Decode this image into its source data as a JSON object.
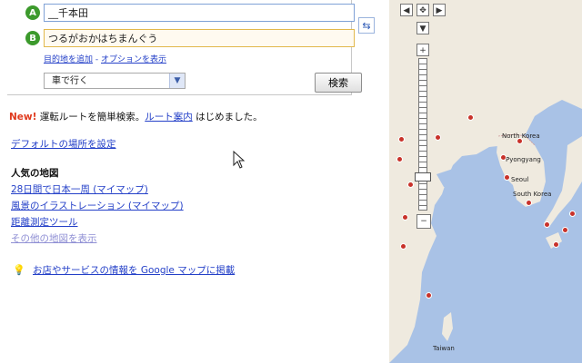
{
  "route": {
    "start_marker": "A",
    "end_marker": "B",
    "start_value": "__千本田",
    "end_value": "つるがおかはちまんぐう",
    "swap_label": "⇆",
    "dest_link_1": "目的地を追加",
    "dest_sep": " - ",
    "dest_link_2": "オプションを表示",
    "mode_value": "車で行く",
    "search_label": "検索"
  },
  "announcement": {
    "new_label": "New!",
    "text_before": " 運転ルートを簡単検索。",
    "link_text": "ルート案内",
    "text_after": " はじめました。"
  },
  "default_location_link": "デフォルトの場所を設定",
  "popular_maps": {
    "title": "人気の地図",
    "items": [
      "28日間で日本一周 (マイマップ)",
      "風景のイラストレーション (マイマップ)",
      "距離測定ツール",
      "その他の地図を表示"
    ]
  },
  "tip": {
    "bulb_icon": "lightbulb-icon",
    "link_text": "お店やサービスの情報を Google マップに掲載"
  },
  "map": {
    "labels": [
      "North Korea",
      "Pyongyang",
      "Seoul",
      "South Korea",
      "Taiwan"
    ],
    "sea_color": "#a9c2e6",
    "land_color": "#efeadf"
  }
}
